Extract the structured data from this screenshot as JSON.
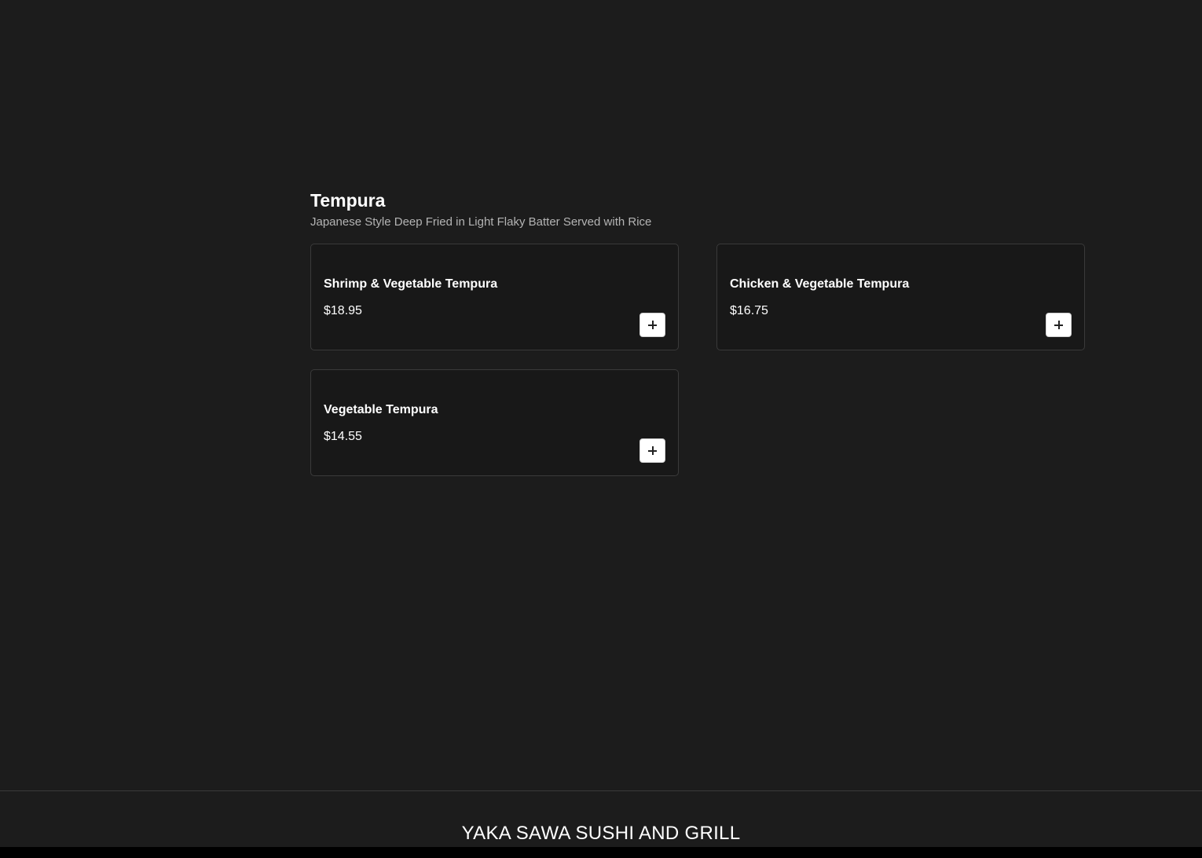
{
  "menu_section": {
    "title": "Tempura",
    "description": "Japanese Style Deep Fried in Light Flaky Batter Served with Rice",
    "items": [
      {
        "name": "Shrimp & Vegetable Tempura",
        "price": "$18.95",
        "add_icon": "plus-icon"
      },
      {
        "name": "Chicken & Vegetable Tempura",
        "price": "$16.75",
        "add_icon": "plus-icon"
      },
      {
        "name": "Vegetable Tempura",
        "price": "$14.55",
        "add_icon": "plus-icon"
      }
    ]
  },
  "footer": {
    "restaurant_name": "YAKA SAWA SUSHI AND GRILL"
  },
  "colors": {
    "background": "#1c1c1c",
    "card_background": "#181818",
    "card_border": "#3a3a3a",
    "button_background": "#ffffff",
    "description_text": "#b4b4b4"
  }
}
